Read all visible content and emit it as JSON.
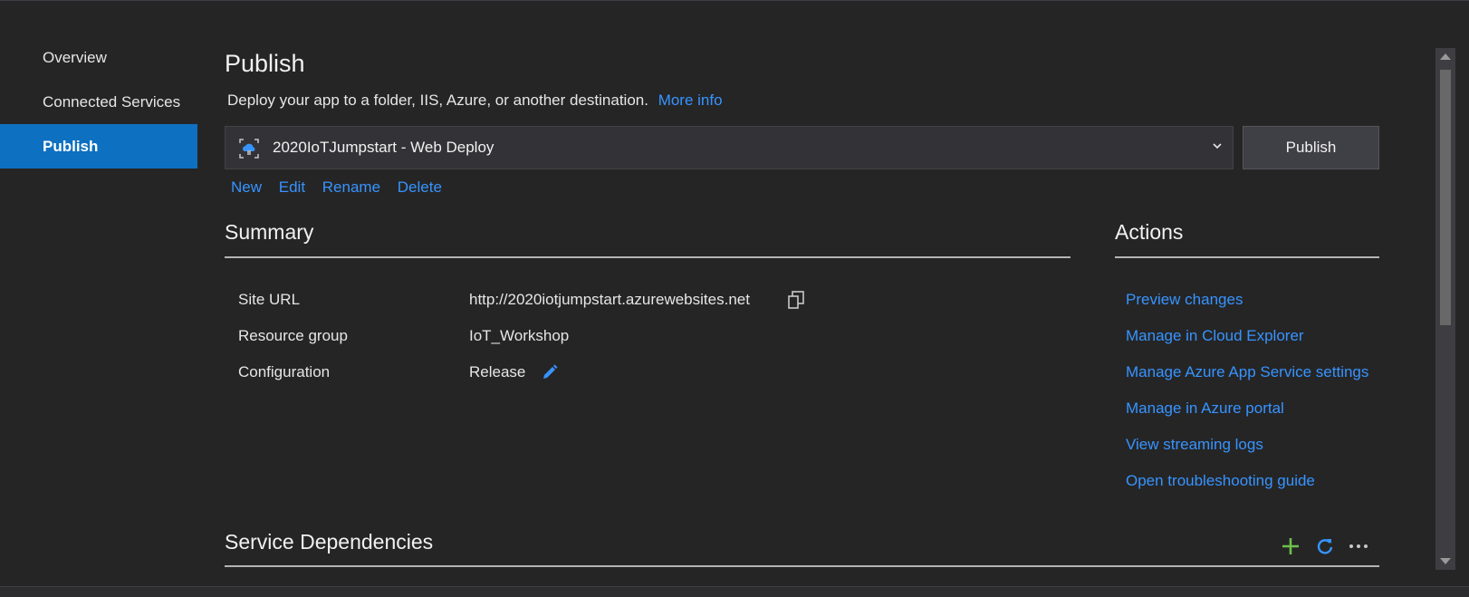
{
  "sidebar": {
    "items": [
      {
        "label": "Overview"
      },
      {
        "label": "Connected Services"
      },
      {
        "label": "Publish"
      }
    ]
  },
  "header": {
    "title": "Publish",
    "subtitle": "Deploy your app to a folder, IIS, Azure, or another destination.",
    "more_info": "More info"
  },
  "profile": {
    "selected": "2020IoTJumpstart - Web Deploy",
    "publish_label": "Publish",
    "actions": [
      "New",
      "Edit",
      "Rename",
      "Delete"
    ]
  },
  "summary": {
    "title": "Summary",
    "rows": [
      {
        "label": "Site URL",
        "value": "http://2020iotjumpstart.azurewebsites.net"
      },
      {
        "label": "Resource group",
        "value": "IoT_Workshop"
      },
      {
        "label": "Configuration",
        "value": "Release"
      }
    ]
  },
  "actions": {
    "title": "Actions",
    "links": [
      "Preview changes",
      "Manage in Cloud Explorer",
      "Manage Azure App Service settings",
      "Manage in Azure portal",
      "View streaming logs",
      "Open troubleshooting guide"
    ]
  },
  "dependencies": {
    "title": "Service Dependencies"
  },
  "icons": {
    "profile": "azure-web-deploy-icon",
    "copy": "copy-icon",
    "edit": "pencil-icon",
    "add": "plus-icon",
    "refresh": "refresh-icon",
    "more": "more-icon"
  },
  "colors": {
    "accent": "#0e70c0",
    "link": "#3794ff",
    "add_green": "#6cc04a"
  }
}
